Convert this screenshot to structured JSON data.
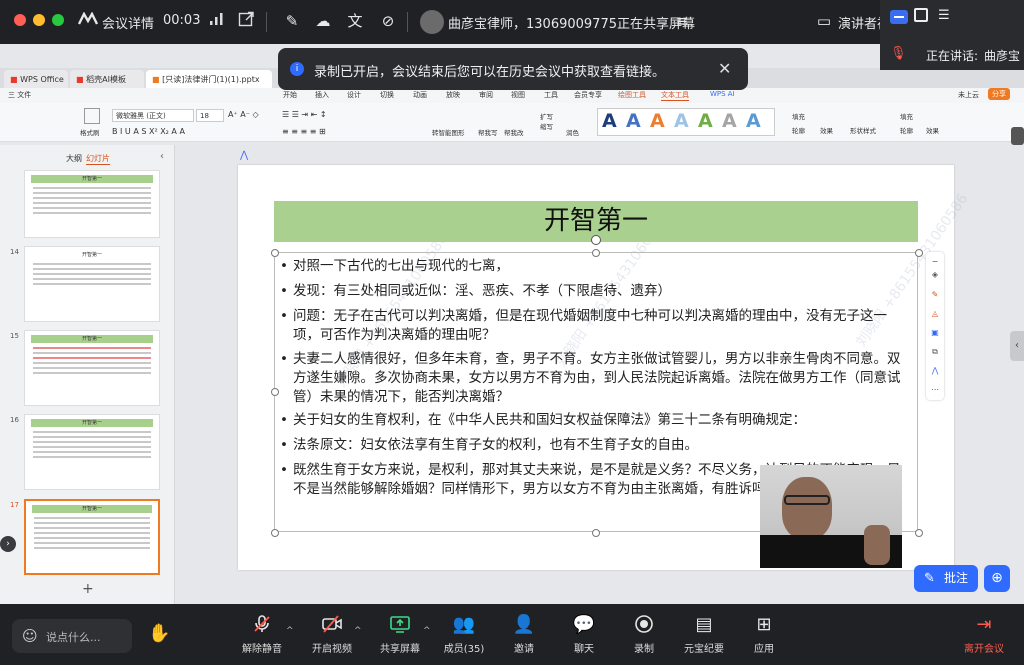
{
  "meeting": {
    "details_label": "会议详情",
    "timer": "00:03",
    "sharing_notice": "曲彦宝律师，13069009775正在共享屏幕",
    "presenter_label": "演讲者视",
    "speaking_prefix": "正在讲话:",
    "speaking_name": "曲彦宝"
  },
  "toast": {
    "message": "录制已开启，会议结束后您可以在历史会议中获取查看链接。"
  },
  "wps": {
    "tabs": [
      "WPS Office",
      "稻壳AI模板",
      "[只读]法律讲门(1)(1).pptx"
    ],
    "menu": [
      "三 文件",
      "开始",
      "插入",
      "设计",
      "切换",
      "动画",
      "放映",
      "审阅",
      "视图",
      "工具",
      "会员专享",
      "绘图工具",
      "文本工具",
      "WPS AI"
    ],
    "menu_right": [
      "未上云",
      "分享"
    ],
    "font_name": "微软雅黑 (正文)",
    "font_size": "18",
    "ribbon_labels": [
      "格式刷",
      "转智能图形",
      "帮我写",
      "帮我改",
      "扩写",
      "缩写",
      "润色",
      "填充",
      "轮廓",
      "效果",
      "形状样式",
      "填充",
      "轮廓",
      "效果"
    ],
    "panel_tabs": [
      "大纲",
      "幻灯片"
    ],
    "slide_numbers": [
      "14",
      "15",
      "16",
      "17"
    ],
    "thumb_title": "开智第一",
    "add_label": "+"
  },
  "slide": {
    "title": "开智第一",
    "bullets": [
      "对照一下古代的七出与现代的七离，",
      "发现：有三处相同或近似：淫、恶疾、不孝（下限虐待、遗弃）",
      "问题：无子在古代可以判决离婚，但是在现代婚姻制度中七种可以判决离婚的理由中，没有无子这一项，可否作为判决离婚的理由呢？",
      "夫妻二人感情很好，但多年未育，查，男子不育。女方主张做试管婴儿，男方以非亲生骨肉不同意。双方遂生嫌隙。多次协商未果，女方以男方不育为由，到人民法院起诉离婚。法院在做男方工作（同意试管）未果的情况下，能否判决离婚？",
      "关于妇女的生育权利，在《中华人民共和国妇女权益保障法》第三十二条有明确规定：",
      "法条原文：妇女依法享有生育子女的权利，也有不生育子女的自由。",
      "既然生育于女方来说，是权利，那对其丈夫来说，是不是就是义务？不尽义务，达到目的不能实现，是不是当然能够解除婚姻？同样情形下，男方以女方不育为由主张离婚，有胜诉吗？能，但忽依据不足。"
    ],
    "watermark": "刘晓阳 +86155431060586"
  },
  "annotate": {
    "label": "批注"
  },
  "bottom": {
    "say_placeholder": "说点什么...",
    "buttons": [
      "解除静音",
      "开启视频",
      "共享屏幕",
      "成员(35)",
      "邀请",
      "聊天",
      "录制",
      "元宝纪要",
      "应用"
    ],
    "leave": "离开会议"
  },
  "colors": {
    "accent": "#2f6bff",
    "leave": "#ff5a4e",
    "title_fill": "#a9d08e"
  }
}
